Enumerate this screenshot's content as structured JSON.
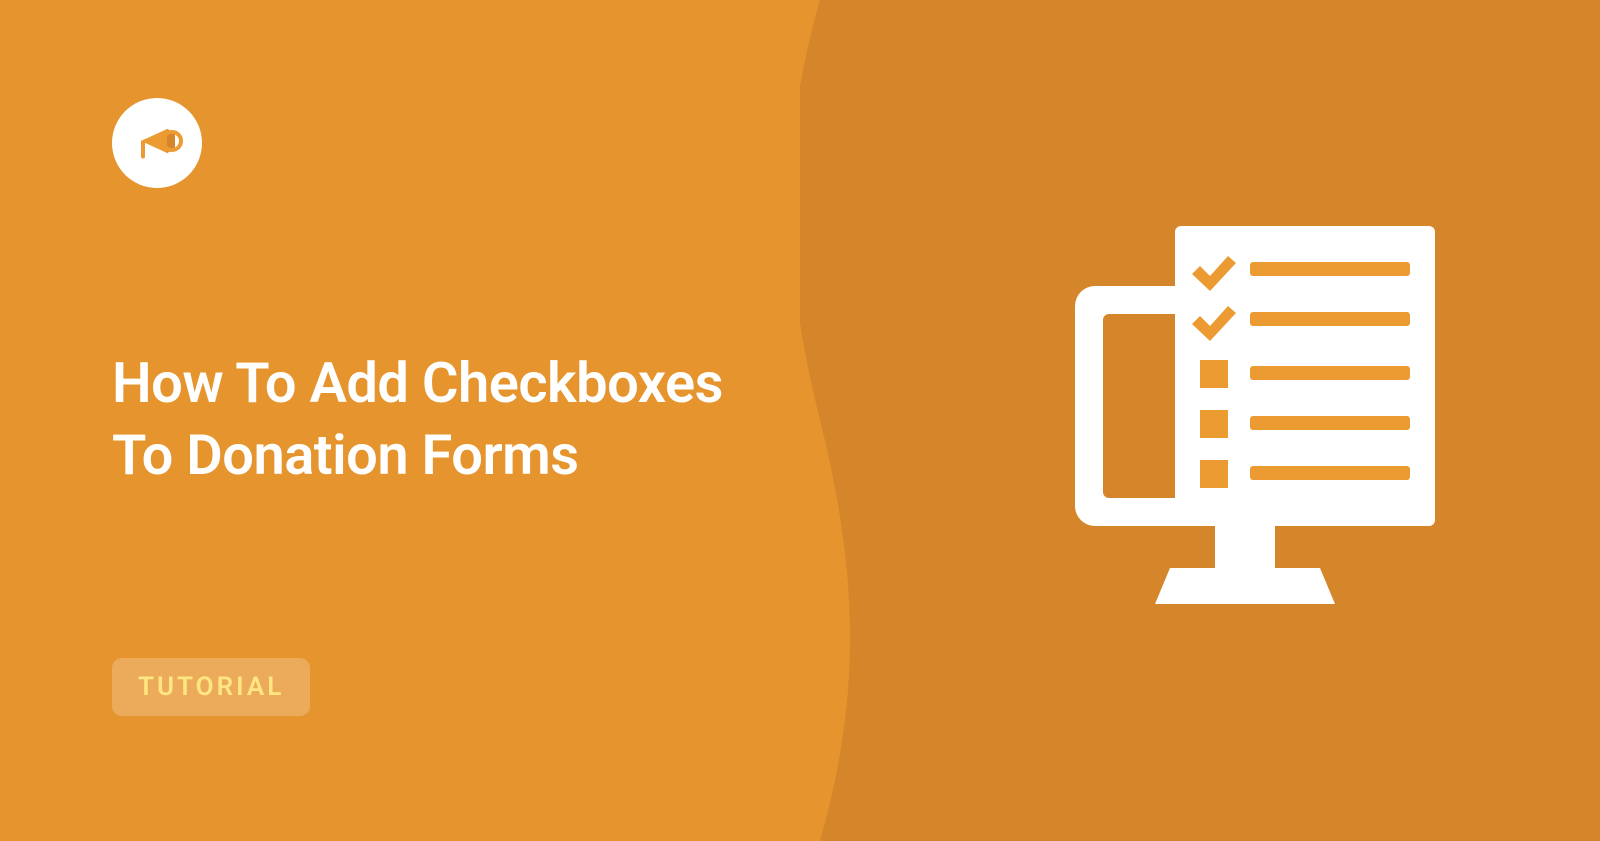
{
  "title_line1": "How To Add Checkboxes",
  "title_line2": "To Donation Forms",
  "badge_label": "TUTORIAL",
  "colors": {
    "bg_left": "#e6942e",
    "bg_right": "#d5862a",
    "accent": "#eb9b31",
    "badge_text": "#ffe680"
  }
}
